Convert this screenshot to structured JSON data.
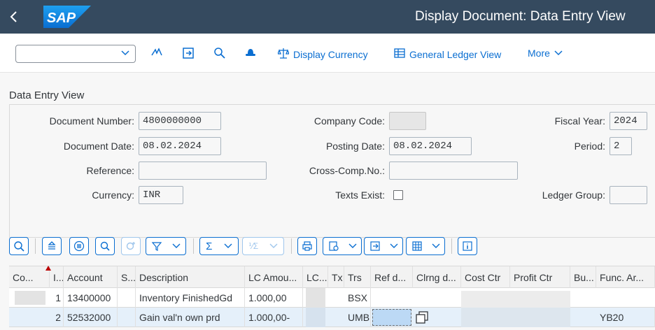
{
  "shell": {
    "back_icon": "chevron-left-icon",
    "logo": "SAP",
    "title": "Display Document: Data Entry View"
  },
  "toolbar": {
    "dropdown_value": "",
    "display_currency": "Display Currency",
    "general_ledger_view": "General Ledger View",
    "more": "More"
  },
  "panel": {
    "title": "Data Entry View",
    "doc_number_label": "Document Number:",
    "doc_number": "4800000000",
    "company_code_label": "Company Code:",
    "company_code": "",
    "fiscal_year_label": "Fiscal Year:",
    "fiscal_year": "2024",
    "doc_date_label": "Document Date:",
    "doc_date": "08.02.2024",
    "posting_date_label": "Posting Date:",
    "posting_date": "08.02.2024",
    "period_label": "Period:",
    "period": "2",
    "reference_label": "Reference:",
    "reference": "",
    "cross_comp_label": "Cross-Comp.No.:",
    "cross_comp": "",
    "currency_label": "Currency:",
    "currency": "INR",
    "texts_exist_label": "Texts Exist:",
    "ledger_group_label": "Ledger Group:",
    "ledger_group": ""
  },
  "grid": {
    "headers": [
      "Co...",
      "I...",
      "Account",
      "S...",
      "Description",
      "LC Amou...",
      "LC...",
      "Tx",
      "Trs",
      "Ref d...",
      "Clrng d...",
      "Cost Ctr",
      "Profit Ctr",
      "Bu...",
      "Func. Ar..."
    ],
    "rows": [
      [
        "",
        "1",
        "13400000",
        "",
        "Inventory FinishedGd",
        "1.000,00",
        "",
        "",
        "BSX",
        "",
        "",
        "",
        "",
        "",
        ""
      ],
      [
        "",
        "2",
        "52532000",
        "",
        "Gain val'n own prd",
        "1.000,00-",
        "",
        "",
        "UMB",
        "",
        "",
        "",
        "",
        "",
        "YB20"
      ]
    ]
  }
}
